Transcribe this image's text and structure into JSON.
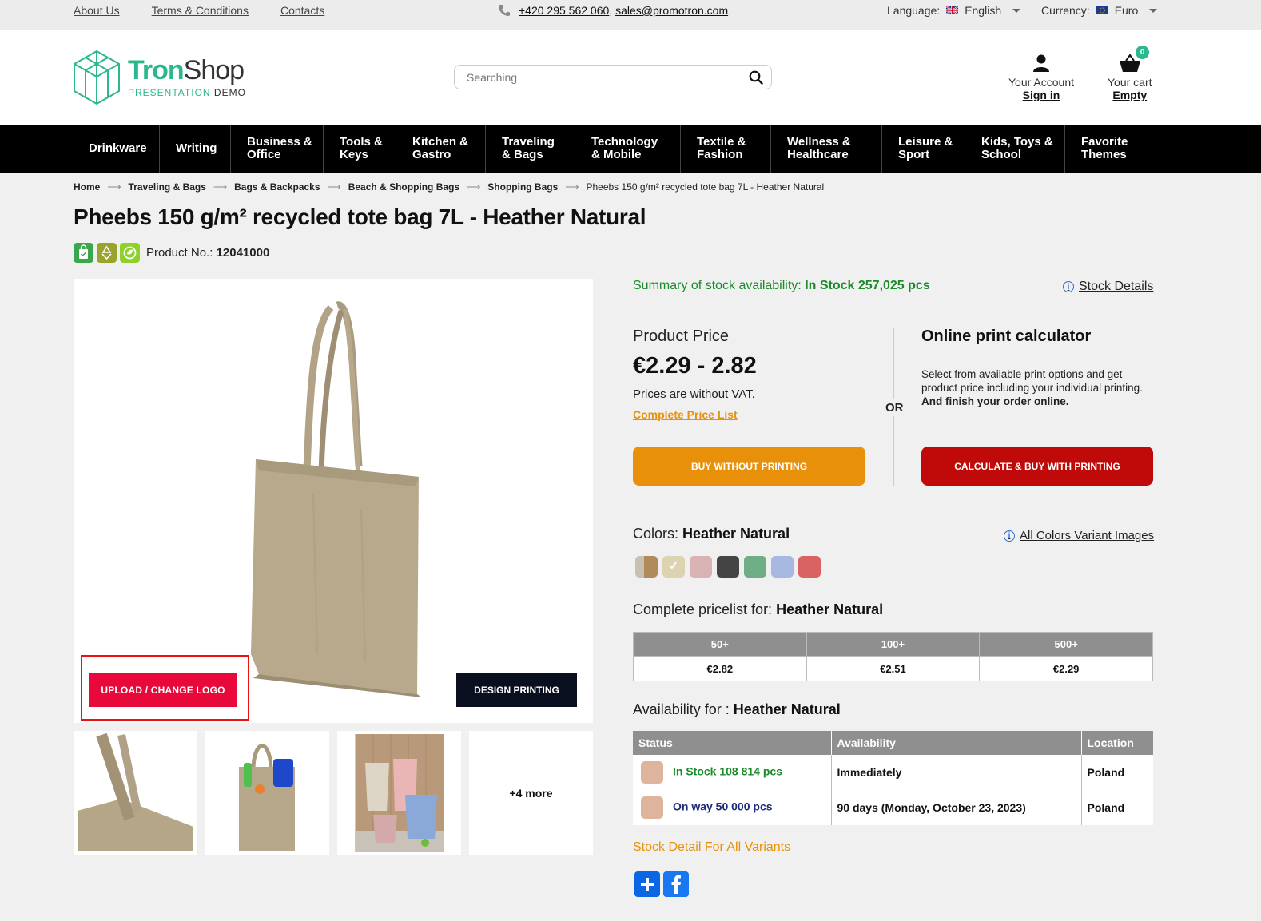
{
  "topbar": {
    "links": [
      "About Us",
      "Terms & Conditions",
      "Contacts"
    ],
    "phone": "+420 295 562 060",
    "email": "sales@promotron.com",
    "language_label": "Language:",
    "language_value": "English",
    "currency_label": "Currency:",
    "currency_value": "Euro"
  },
  "logo": {
    "name_a": "Tron",
    "name_b": "Shop",
    "sub_a": "PRESENTATION ",
    "sub_b": "DEMO"
  },
  "search": {
    "placeholder": "Searching"
  },
  "account": {
    "label": "Your Account",
    "link": "Sign in"
  },
  "cart": {
    "label": "Your cart",
    "link": "Empty",
    "count": "0"
  },
  "nav": [
    {
      "l1": "Drinkware",
      "l2": ""
    },
    {
      "l1": "Writing",
      "l2": ""
    },
    {
      "l1": "Business &",
      "l2": "Office"
    },
    {
      "l1": "Tools &",
      "l2": "Keys"
    },
    {
      "l1": "Kitchen &",
      "l2": "Gastro"
    },
    {
      "l1": "Traveling",
      "l2": "& Bags"
    },
    {
      "l1": "Technology",
      "l2": "& Mobile"
    },
    {
      "l1": "Textile &",
      "l2": "Fashion"
    },
    {
      "l1": "Wellness &",
      "l2": "Healthcare"
    },
    {
      "l1": "Leisure &",
      "l2": "Sport"
    },
    {
      "l1": "Kids, Toys &",
      "l2": "School"
    },
    {
      "l1": "Favorite",
      "l2": "Themes"
    }
  ],
  "breadcrumb": [
    "Home",
    "Traveling & Bags",
    "Bags & Backpacks",
    "Beach & Shopping Bags",
    "Shopping Bags",
    "Pheebs 150 g/m² recycled tote bag 7L - Heather Natural"
  ],
  "product": {
    "title": "Pheebs 150 g/m² recycled tote bag 7L - Heather Natural",
    "no_label": "Product No.:",
    "no_value": "12041000",
    "upload_label": "UPLOAD / CHANGE LOGO",
    "design_label": "DESIGN PRINTING",
    "more_label": "+4 more"
  },
  "stock": {
    "summary_label": "Summary of stock availability:",
    "summary_value": "In Stock 257,025 pcs",
    "details_link": "Stock Details"
  },
  "price": {
    "label": "Product Price",
    "value": "€2.29 - 2.82",
    "vat": "Prices are without VAT.",
    "list_link": "Complete Price List",
    "or": "OR",
    "buy_label": "BUY WITHOUT PRINTING",
    "calc_title": "Online print calculator",
    "calc_desc": "Select from available print options and get product price including your individual printing.",
    "calc_desc_bold": "And finish your order online.",
    "calc_label": "CALCULATE & BUY WITH PRINTING"
  },
  "colors": {
    "label": "Colors:",
    "selected": "Heather Natural",
    "all_link": "All Colors Variant Images",
    "swatches": [
      "#b08a5a",
      "#ddd3b0",
      "#d9b3b3",
      "#444444",
      "#6fae84",
      "#a9b8e0",
      "#d96363"
    ]
  },
  "pricelist": {
    "label": "Complete pricelist for:",
    "variant": "Heather Natural",
    "headers": [
      "50+",
      "100+",
      "500+"
    ],
    "values": [
      "€2.82",
      "€2.51",
      "€2.29"
    ]
  },
  "availability": {
    "label": "Availability for :",
    "variant": "Heather Natural",
    "headers": [
      "Status",
      "Availability",
      "Location"
    ],
    "rows": [
      {
        "status": "In Stock 108 814 pcs",
        "availability": "Immediately",
        "location": "Poland"
      },
      {
        "status": "On way 50 000 pcs",
        "availability": "90 days (Monday, October 23, 2023)",
        "location": "Poland"
      }
    ]
  },
  "stock_all_link": "Stock Detail For All Variants",
  "colors_theme": {
    "accent": "#2cb88f",
    "orange": "#e8900a",
    "red": "#c00a0a",
    "pink": "#e8083a"
  }
}
